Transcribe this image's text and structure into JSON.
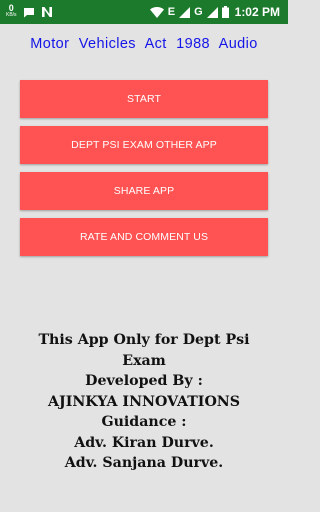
{
  "status_bar": {
    "net_speed": "0",
    "net_unit": "KB/s",
    "network_type": "E",
    "network_type_2": "G",
    "time": "1:02 PM",
    "icons": [
      "sms-icon",
      "notification-n-icon",
      "wifi-icon",
      "signal-icon",
      "battery-icon"
    ]
  },
  "app_title": "Motor Vehicles Act 1988 Audio",
  "buttons": {
    "start": "START",
    "dept_psi": "DEPT PSI EXAM OTHER APP",
    "share": "SHARE APP",
    "rate": "RATE AND COMMENT US"
  },
  "info_lines": [
    "This App Only for Dept Psi",
    "Exam",
    "Developed By :",
    "AJINKYA INNOVATIONS",
    "Guidance :",
    "Adv. Kiran Durve.",
    "Adv. Sanjana Durve."
  ],
  "colors": {
    "status_bar": "#1c7a2c",
    "title_blue": "#1515e8",
    "button_red": "#ff5252",
    "background": "#e3e3e3"
  }
}
